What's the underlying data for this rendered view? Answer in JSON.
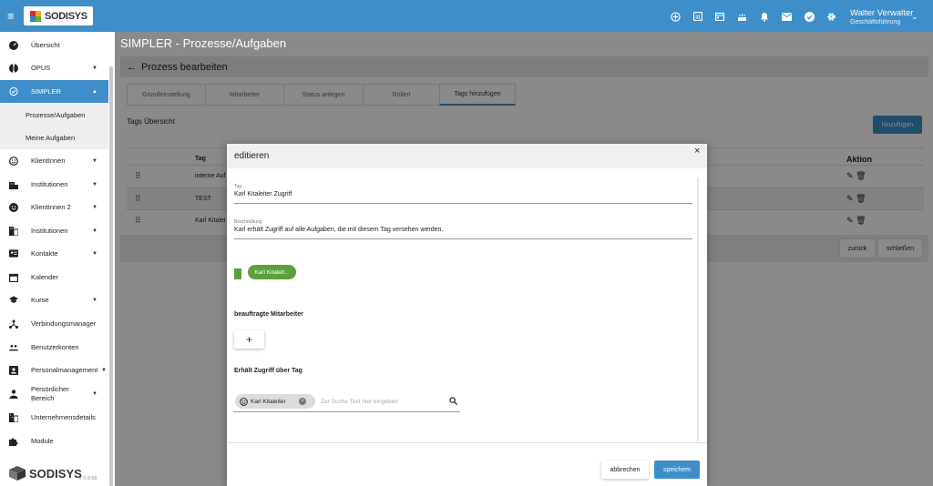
{
  "topbar": {
    "brand": "SODISYS",
    "icons": [
      "add-circle-icon",
      "calendar-badge-icon",
      "calendar-icon",
      "cake-icon",
      "bell-icon",
      "mail-icon",
      "check-circle-icon",
      "gear-icon"
    ],
    "user_name": "Walter Verwalter",
    "user_role": "Geschäftsführung"
  },
  "sidebar": {
    "items": [
      {
        "label": "Übersicht",
        "icon": "speedometer-icon"
      },
      {
        "label": "OPUS",
        "icon": "opus-icon"
      },
      {
        "label": "SIMPLER",
        "icon": "simpler-icon"
      },
      {
        "label": "KlientInnen",
        "icon": "smiley-icon"
      },
      {
        "label": "Institutionen",
        "icon": "building-icon"
      },
      {
        "label": "KlientInnen 2",
        "icon": "smiley-filled-icon"
      },
      {
        "label": "Institutionen",
        "icon": "company-icon"
      },
      {
        "label": "Kontakte",
        "icon": "contact-card-icon"
      },
      {
        "label": "Kalender",
        "icon": "calendar-icon"
      },
      {
        "label": "Kurse",
        "icon": "graduation-cap-icon"
      },
      {
        "label": "Verbindungsmanager",
        "icon": "network-icon"
      },
      {
        "label": "Benutzerkonten",
        "icon": "users-icon"
      },
      {
        "label": "Personalmanagement",
        "icon": "badge-icon"
      },
      {
        "label": "Persönlicher Bereich",
        "icon": "person-icon"
      },
      {
        "label": "Unternehmensdetails",
        "icon": "business-icon"
      },
      {
        "label": "Module",
        "icon": "puzzle-icon"
      }
    ],
    "subitems": [
      "Prozesse/Aufgaben",
      "Meine Aufgaben"
    ],
    "brand": "SODISYS",
    "version": "V 0.8.68"
  },
  "page": {
    "title": "SIMPLER - Prozesse/Aufgaben",
    "card_title": "Prozess bearbeiten",
    "tabs": [
      "Grundeinstellung",
      "Mitarbeiter",
      "Status anlegen",
      "Rollen",
      "Tags hinzufügen"
    ],
    "active_tab": "Tags hinzufügen",
    "section_title": "Tags Übersicht",
    "add_button": "hinzufügen",
    "table": {
      "headers": [
        "Tag",
        "Aktion"
      ],
      "rows": [
        {
          "tag": "interne Auf"
        },
        {
          "tag": "TEST"
        },
        {
          "tag": "Karl Kitalei"
        }
      ]
    },
    "back_button": "zurück",
    "close_button": "schließen"
  },
  "modal": {
    "title": "editieren",
    "close": "×",
    "tag_label": "Tag",
    "tag_value": "Karl Kitaleiter Zugriff",
    "desc_label": "Beschreibung",
    "desc_value": "Karl erhält Zugriff auf alle Aufgaben, die mit diesem Tag versehen werden.",
    "tag_color": "#5e9e3c",
    "chip_preview": "Karl Kitaleit...",
    "assigned_label": "beauftragte Mitarbeiter",
    "add_symbol": "+",
    "access_label": "Erhält Zugriff über Tag",
    "access_chip": "Karl Kitaleiter",
    "search_placeholder": "Zur Suche Text hier eingeben",
    "cancel": "abbrechen",
    "save": "speichem"
  },
  "colors": {
    "primary": "#3d8ec9",
    "overlay": "#8a8a8a",
    "tag_green": "#5e9e3c"
  }
}
